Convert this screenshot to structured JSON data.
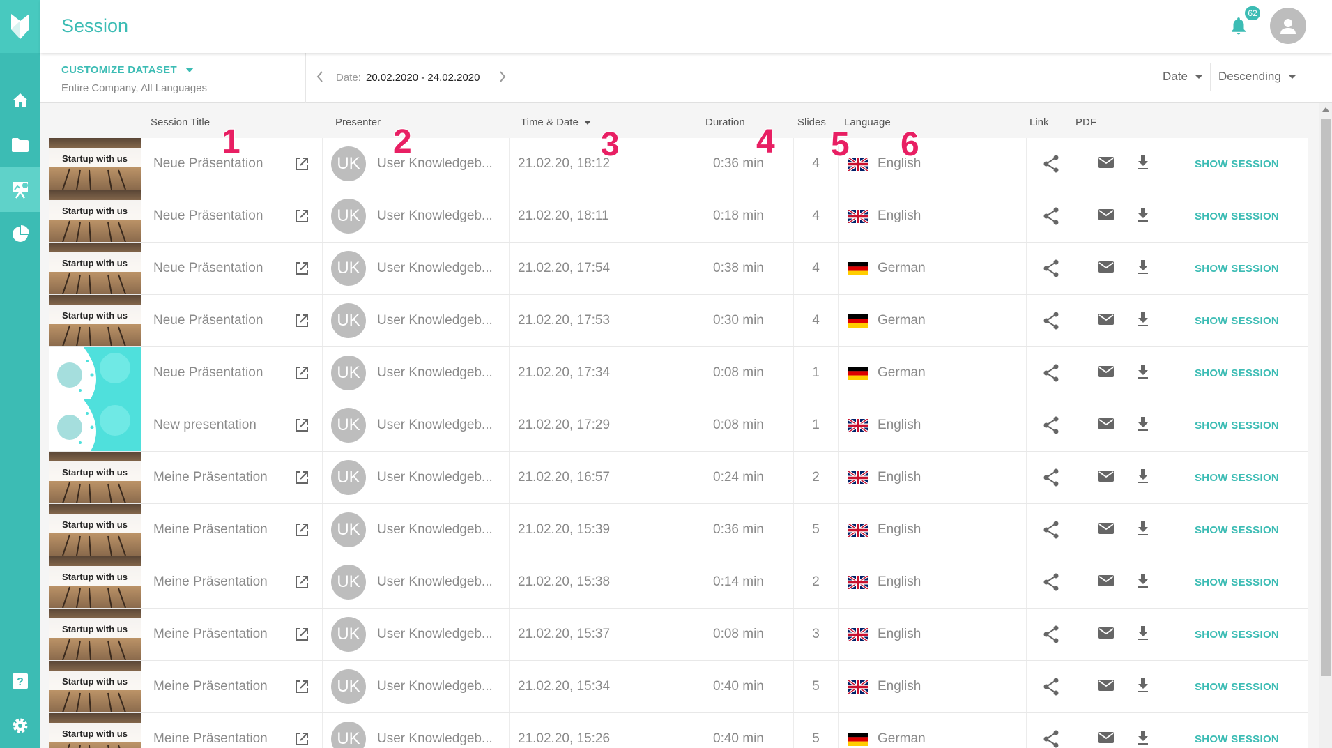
{
  "app": {
    "title": "Session",
    "notification_count": "62"
  },
  "filter": {
    "customize_label": "CUSTOMIZE DATASET",
    "scope": "Entire Company,  All Languages",
    "date_label": "Date:",
    "date_range": "20.02.2020 - 24.02.2020",
    "sort_field": "Date",
    "sort_order": "Descending"
  },
  "columns": {
    "title": "Session Title",
    "presenter": "Presenter",
    "time": "Time & Date",
    "duration": "Duration",
    "slides": "Slides",
    "language": "Language",
    "link": "Link",
    "pdf": "PDF"
  },
  "annotations": [
    "1",
    "2",
    "3",
    "4",
    "5",
    "6"
  ],
  "show_session_label": "SHOW SESSION",
  "thumbnail_text": "Startup with us",
  "colors": {
    "accent": "#3cbcb4",
    "annotation": "#e81f63"
  },
  "sessions": [
    {
      "title": "Neue Präsentation",
      "initials": "UK",
      "presenter": "User Knowledgeb...",
      "time": "21.02.20, 18:12",
      "duration": "0:36 min",
      "slides": "4",
      "language": "English",
      "flag": "uk",
      "thumb": "startup"
    },
    {
      "title": "Neue Präsentation",
      "initials": "UK",
      "presenter": "User Knowledgeb...",
      "time": "21.02.20, 18:11",
      "duration": "0:18 min",
      "slides": "4",
      "language": "English",
      "flag": "uk",
      "thumb": "startup"
    },
    {
      "title": "Neue Präsentation",
      "initials": "UK",
      "presenter": "User Knowledgeb...",
      "time": "21.02.20, 17:54",
      "duration": "0:38 min",
      "slides": "4",
      "language": "German",
      "flag": "de",
      "thumb": "startup"
    },
    {
      "title": "Neue Präsentation",
      "initials": "UK",
      "presenter": "User Knowledgeb...",
      "time": "21.02.20, 17:53",
      "duration": "0:30 min",
      "slides": "4",
      "language": "German",
      "flag": "de",
      "thumb": "startup"
    },
    {
      "title": "Neue Präsentation",
      "initials": "UK",
      "presenter": "User Knowledgeb...",
      "time": "21.02.20, 17:34",
      "duration": "0:08 min",
      "slides": "1",
      "language": "German",
      "flag": "de",
      "thumb": "cyan"
    },
    {
      "title": "New presentation",
      "initials": "UK",
      "presenter": "User Knowledgeb...",
      "time": "21.02.20, 17:29",
      "duration": "0:08 min",
      "slides": "1",
      "language": "English",
      "flag": "uk",
      "thumb": "cyan"
    },
    {
      "title": "Meine Präsentation",
      "initials": "UK",
      "presenter": "User Knowledgeb...",
      "time": "21.02.20, 16:57",
      "duration": "0:24 min",
      "slides": "2",
      "language": "English",
      "flag": "uk",
      "thumb": "startup"
    },
    {
      "title": "Meine Präsentation",
      "initials": "UK",
      "presenter": "User Knowledgeb...",
      "time": "21.02.20, 15:39",
      "duration": "0:36 min",
      "slides": "5",
      "language": "English",
      "flag": "uk",
      "thumb": "startup"
    },
    {
      "title": "Meine Präsentation",
      "initials": "UK",
      "presenter": "User Knowledgeb...",
      "time": "21.02.20, 15:38",
      "duration": "0:14 min",
      "slides": "2",
      "language": "English",
      "flag": "uk",
      "thumb": "startup"
    },
    {
      "title": "Meine Präsentation",
      "initials": "UK",
      "presenter": "User Knowledgeb...",
      "time": "21.02.20, 15:37",
      "duration": "0:08 min",
      "slides": "3",
      "language": "English",
      "flag": "uk",
      "thumb": "startup"
    },
    {
      "title": "Meine Präsentation",
      "initials": "UK",
      "presenter": "User Knowledgeb...",
      "time": "21.02.20, 15:34",
      "duration": "0:40 min",
      "slides": "5",
      "language": "English",
      "flag": "uk",
      "thumb": "startup"
    },
    {
      "title": "Meine Präsentation",
      "initials": "UK",
      "presenter": "User Knowledgeb...",
      "time": "21.02.20, 15:26",
      "duration": "0:40 min",
      "slides": "5",
      "language": "German",
      "flag": "de",
      "thumb": "startup"
    }
  ]
}
